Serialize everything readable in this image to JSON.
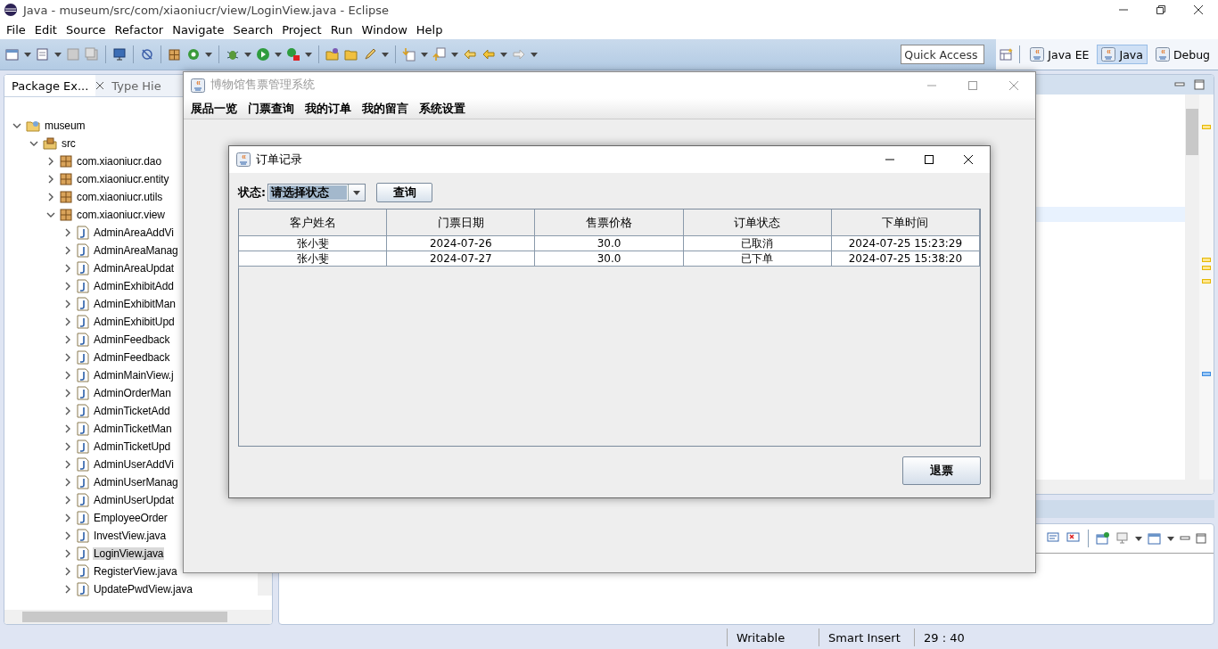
{
  "window": {
    "title": "Java - museum/src/com/xiaoniucr/view/LoginView.java - Eclipse",
    "menu": [
      "File",
      "Edit",
      "Source",
      "Refactor",
      "Navigate",
      "Search",
      "Project",
      "Run",
      "Window",
      "Help"
    ]
  },
  "toolbar": {
    "quick_access": {
      "placeholder": "Quick Access"
    },
    "perspectives": [
      {
        "label": "Java EE",
        "selected": false
      },
      {
        "label": "Java",
        "selected": true
      },
      {
        "label": "Debug",
        "selected": false
      }
    ]
  },
  "package_explorer": {
    "tabs": [
      {
        "label": "Package Ex...",
        "selected": true
      },
      {
        "label": "Type Hie",
        "selected": false
      }
    ],
    "tree": [
      {
        "label": "museum",
        "kind": "project",
        "expanded": true,
        "selected": false,
        "children": [
          {
            "label": "src",
            "kind": "source_folder",
            "expanded": true,
            "selected": false,
            "children": [
              {
                "label": "com.xiaoniucr.dao",
                "kind": "package",
                "expanded": false,
                "selected": false
              },
              {
                "label": "com.xiaoniucr.entity",
                "kind": "package",
                "expanded": false,
                "selected": false
              },
              {
                "label": "com.xiaoniucr.utils",
                "kind": "package",
                "expanded": false,
                "selected": false
              },
              {
                "label": "com.xiaoniucr.view",
                "kind": "package",
                "expanded": true,
                "selected": false,
                "children": [
                  {
                    "label": "AdminAreaAddVi",
                    "kind": "file",
                    "expanded": false,
                    "selected": false
                  },
                  {
                    "label": "AdminAreaManag",
                    "kind": "file",
                    "expanded": false,
                    "selected": false
                  },
                  {
                    "label": "AdminAreaUpdat",
                    "kind": "file",
                    "expanded": false,
                    "selected": false
                  },
                  {
                    "label": "AdminExhibitAdd",
                    "kind": "file",
                    "expanded": false,
                    "selected": false
                  },
                  {
                    "label": "AdminExhibitMan",
                    "kind": "file",
                    "expanded": false,
                    "selected": false
                  },
                  {
                    "label": "AdminExhibitUpd",
                    "kind": "file",
                    "expanded": false,
                    "selected": false
                  },
                  {
                    "label": "AdminFeedback",
                    "kind": "file",
                    "expanded": false,
                    "selected": false
                  },
                  {
                    "label": "AdminFeedback",
                    "kind": "file",
                    "expanded": false,
                    "selected": false
                  },
                  {
                    "label": "AdminMainView.j",
                    "kind": "file",
                    "expanded": false,
                    "selected": false
                  },
                  {
                    "label": "AdminOrderMan",
                    "kind": "file",
                    "expanded": false,
                    "selected": false
                  },
                  {
                    "label": "AdminTicketAdd",
                    "kind": "file",
                    "expanded": false,
                    "selected": false
                  },
                  {
                    "label": "AdminTicketMan",
                    "kind": "file",
                    "expanded": false,
                    "selected": false
                  },
                  {
                    "label": "AdminTicketUpd",
                    "kind": "file",
                    "expanded": false,
                    "selected": false
                  },
                  {
                    "label": "AdminUserAddVi",
                    "kind": "file",
                    "expanded": false,
                    "selected": false
                  },
                  {
                    "label": "AdminUserManag",
                    "kind": "file",
                    "expanded": false,
                    "selected": false
                  },
                  {
                    "label": "AdminUserUpdat",
                    "kind": "file",
                    "expanded": false,
                    "selected": false
                  },
                  {
                    "label": "EmployeeOrder",
                    "kind": "file",
                    "expanded": false,
                    "selected": false
                  },
                  {
                    "label": "InvestView.java",
                    "kind": "file",
                    "expanded": false,
                    "selected": false
                  },
                  {
                    "label": "LoginView.java",
                    "kind": "file",
                    "expanded": false,
                    "selected": true
                  },
                  {
                    "label": "RegisterView.java",
                    "kind": "file",
                    "expanded": false,
                    "selected": false
                  },
                  {
                    "label": "UpdatePwdView.java",
                    "kind": "file",
                    "expanded": false,
                    "selected": false
                  }
                ]
              }
            ]
          }
        ]
      }
    ]
  },
  "app_window": {
    "title": "博物馆售票管理系统",
    "menu": [
      "展品一览",
      "门票查询",
      "我的订单",
      "我的留言",
      "系统设置"
    ],
    "dialog": {
      "title": "订单记录",
      "filter_label": "状态:",
      "status_select": {
        "value": "请选择状态"
      },
      "query_button": "查询",
      "table": {
        "columns": [
          "客户姓名",
          "门票日期",
          "售票价格",
          "订单状态",
          "下单时间"
        ],
        "rows": [
          [
            "张小斐",
            "2024-07-26",
            "30.0",
            "已取消",
            "2024-07-25 15:23:29"
          ],
          [
            "张小斐",
            "2024-07-27",
            "30.0",
            "已下单",
            "2024-07-25 15:38:20"
          ]
        ]
      },
      "refund_button": "退票"
    }
  },
  "status_bar": [
    "Writable",
    "Smart Insert",
    "29 : 40"
  ]
}
